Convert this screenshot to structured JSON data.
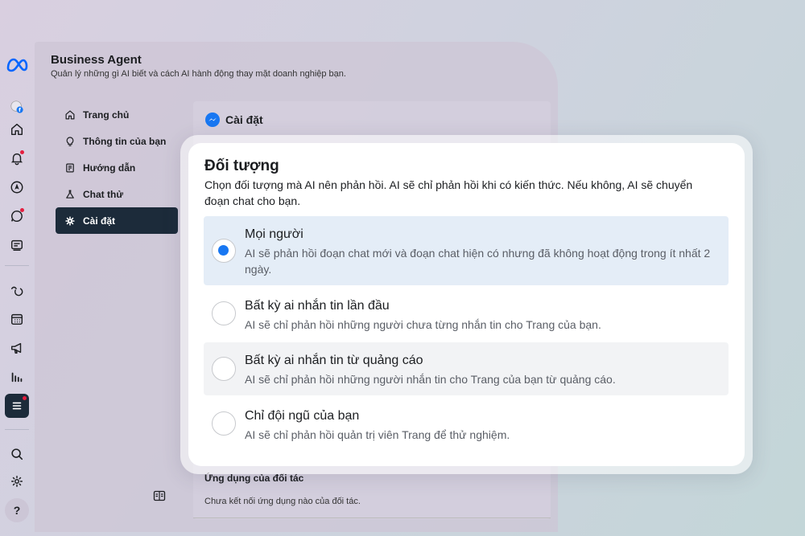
{
  "header": {
    "title": "Business Agent",
    "subtitle": "Quản lý những gì AI biết và cách AI hành động thay mặt doanh nghiệp bạn."
  },
  "nav": {
    "items": [
      {
        "label": "Trang chủ",
        "icon": "home-icon"
      },
      {
        "label": "Thông tin của bạn",
        "icon": "lightbulb-icon"
      },
      {
        "label": "Hướng dẫn",
        "icon": "guide-icon"
      },
      {
        "label": "Chat thử",
        "icon": "flask-icon"
      },
      {
        "label": "Cài đặt",
        "icon": "gear-icon",
        "active": true
      }
    ]
  },
  "content": {
    "title": "Cài đặt",
    "partner_title": "Ứng dụng của đối tác",
    "partner_sub": "Chưa kết nối ứng dụng nào của đối tác."
  },
  "modal": {
    "title": "Đối tượng",
    "description": "Chọn đối tượng mà AI nên phản hồi. AI sẽ chỉ phản hồi khi có kiến thức. Nếu không, AI sẽ chuyển đoạn chat cho bạn.",
    "options": [
      {
        "label": "Mọi người",
        "desc": "AI sẽ phản hồi đoạn chat mới và đoạn chat hiện có nhưng đã không hoạt động trong ít nhất 2 ngày.",
        "selected": true
      },
      {
        "label": "Bất kỳ ai nhắn tin lần đầu",
        "desc": "AI sẽ chỉ phản hồi những người chưa từng nhắn tin cho Trang của bạn.",
        "selected": false
      },
      {
        "label": "Bất kỳ ai nhắn tin từ quảng cáo",
        "desc": "AI sẽ chỉ phản hồi những người nhắn tin cho Trang của bạn từ quảng cáo.",
        "selected": false
      },
      {
        "label": "Chỉ đội ngũ của bạn",
        "desc": "AI sẽ chỉ phản hồi quản trị viên Trang để thử nghiệm.",
        "selected": false
      }
    ]
  },
  "rail": {
    "help_label": "?",
    "accent": "#1877f2",
    "dark": "#1c2b3a"
  }
}
